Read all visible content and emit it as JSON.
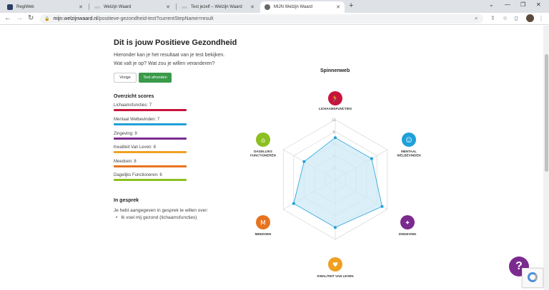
{
  "browser": {
    "tabs": [
      {
        "label": "RegiWeb",
        "fav_color": "#2c3e66",
        "active": false
      },
      {
        "label": "Welzijn Waard",
        "fav_color": "#c9c9c9",
        "active": false
      },
      {
        "label": "Test jezelf – Welzijn Waard",
        "fav_color": "#c9c9c9",
        "active": false
      },
      {
        "label": "MIJN Welzijn Waard",
        "fav_color": "#666666",
        "active": true
      }
    ],
    "url_host": "mijn.welzijnwaard.nl",
    "url_path": "/positieve-gezondheid-test?currentStepName=result"
  },
  "page": {
    "title": "Dit is jouw Positieve Gezondheid",
    "intro_line1": "Hieronder kan je het resultaat van je test bekijken.",
    "intro_line2": "Wat valt je op? Wat zou je willen veranderen?",
    "btn_prev": "Vorige",
    "btn_end": "Test afronden",
    "overview_title": "Overzicht scores",
    "scores": [
      {
        "label": "Lichaamsfuncties: 7",
        "color": "#c8143c"
      },
      {
        "label": "Mentaal Welbevinden: 7",
        "color": "#1ea0d8"
      },
      {
        "label": "Zingeving: 9",
        "color": "#7b2a8e"
      },
      {
        "label": "Kwaliteit Van Leven: 8",
        "color": "#f0a020"
      },
      {
        "label": "Meedoen: 8",
        "color": "#e8731e"
      },
      {
        "label": "Dagelijks Functioneren: 6",
        "color": "#8cc020"
      }
    ],
    "gesprek_title": "In gesprek",
    "gesprek_text": "Je hebt aangegeven in gesprek te willen over:",
    "gesprek_items": [
      "Ik voel mij gezond (lichaamsfuncties)"
    ]
  },
  "chart_data": {
    "type": "radar",
    "title": "Spinnenweb",
    "rmax": 10,
    "ticks": [
      "2",
      "4",
      "6",
      "8",
      "10"
    ],
    "axes": [
      {
        "name": "LICHAAMSFUNCTIES",
        "value": 7,
        "color": "#c8143c"
      },
      {
        "name": "MENTAAL WELBEVINDEN",
        "value": 7,
        "color": "#1ea0d8"
      },
      {
        "name": "ZINGEVING",
        "value": 9,
        "color": "#7b2a8e"
      },
      {
        "name": "KWALITEIT VAN LEVEN",
        "value": 8,
        "color": "#f0a020"
      },
      {
        "name": "MEEDOEN",
        "value": 8,
        "color": "#e8731e"
      },
      {
        "name": "DAGELIJKS FUNCTIONEREN",
        "value": 6,
        "color": "#8cc020"
      }
    ],
    "fill_color": "#cfeaf7",
    "point_color": "#1ea0d8"
  }
}
